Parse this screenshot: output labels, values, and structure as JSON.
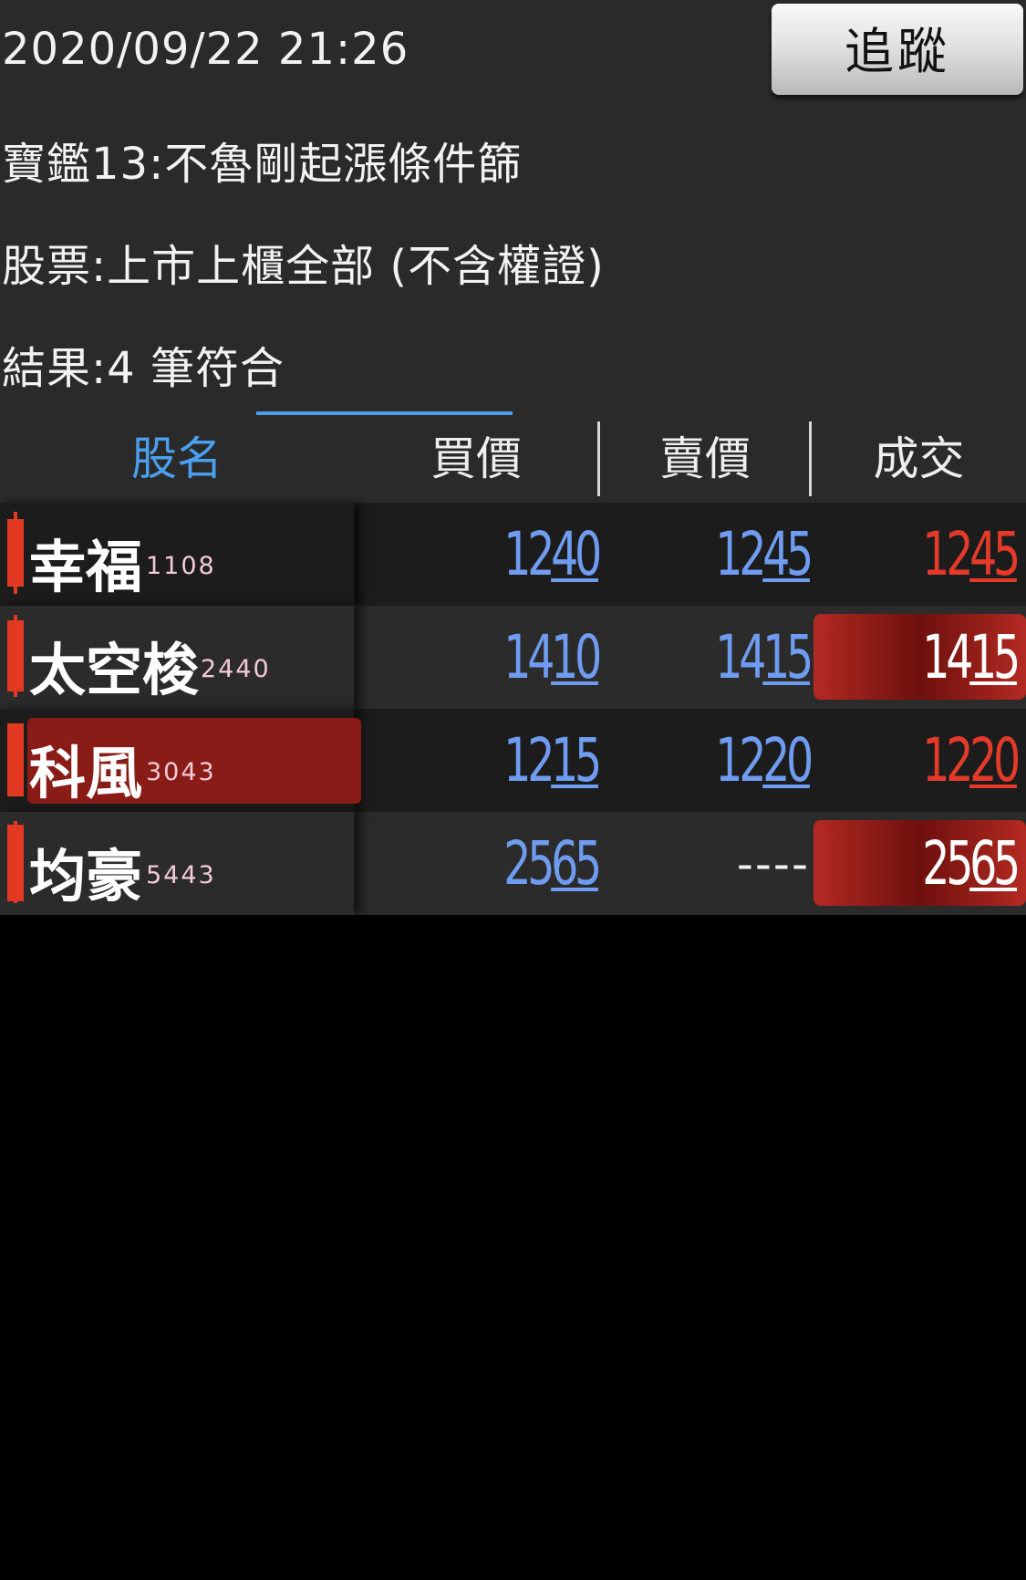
{
  "info": {
    "datetime": "2020/09/22 21:26",
    "strategy": "寶鑑13:不魯剛起漲條件篩",
    "scope": "股票:上市上櫃全部 (不含權證)",
    "result": "結果:4 筆符合"
  },
  "track_button": {
    "label": "追蹤"
  },
  "table": {
    "headers": {
      "name": "股名",
      "bid": "買價",
      "ask": "賣價",
      "last": "成交"
    },
    "rows": [
      {
        "name": "幸福",
        "code": "1108",
        "bid_int": "12",
        "bid_dec": "40",
        "ask_int": "12",
        "ask_dec": "45",
        "ask_text": "",
        "last_int": "12",
        "last_dec": "45"
      },
      {
        "name": "太空梭",
        "code": "2440",
        "bid_int": "14",
        "bid_dec": "10",
        "ask_int": "14",
        "ask_dec": "15",
        "ask_text": "",
        "last_int": "14",
        "last_dec": "15"
      },
      {
        "name": "科風",
        "code": "3043",
        "bid_int": "12",
        "bid_dec": "15",
        "ask_int": "12",
        "ask_dec": "20",
        "ask_text": "",
        "last_int": "12",
        "last_dec": "20"
      },
      {
        "name": "均豪",
        "code": "5443",
        "bid_int": "25",
        "bid_dec": "65",
        "ask_int": "",
        "ask_dec": "",
        "ask_text": "----",
        "last_int": "25",
        "last_dec": "65"
      }
    ]
  },
  "colors": {
    "accent": "#4aa0ee",
    "price_blue": "#6f9cf0",
    "up_red": "#e43a2a",
    "highlight_red": "#8a1c17"
  }
}
